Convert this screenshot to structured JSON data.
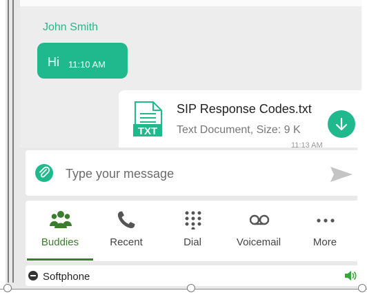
{
  "chat": {
    "sender": "John Smith",
    "message": {
      "text": "Hi",
      "time": "11:10 AM"
    },
    "file": {
      "name": "SIP Response Codes.txt",
      "meta": "Text Document, Size: 9 K",
      "time": "11:13 AM",
      "icon_label": "TXT"
    }
  },
  "composer": {
    "placeholder": "Type your message"
  },
  "nav": {
    "items": [
      {
        "label": "Buddies",
        "icon": "buddies-icon",
        "active": true
      },
      {
        "label": "Recent",
        "icon": "phone-icon",
        "active": false
      },
      {
        "label": "Dial",
        "icon": "dialpad-icon",
        "active": false
      },
      {
        "label": "Voicemail",
        "icon": "voicemail-icon",
        "active": false
      },
      {
        "label": "More",
        "icon": "more-icon",
        "active": false
      }
    ]
  },
  "status": {
    "label": "Softphone"
  },
  "colors": {
    "accent": "#1fb98d",
    "active_nav": "#3a7d2c",
    "background": "#ededed"
  }
}
